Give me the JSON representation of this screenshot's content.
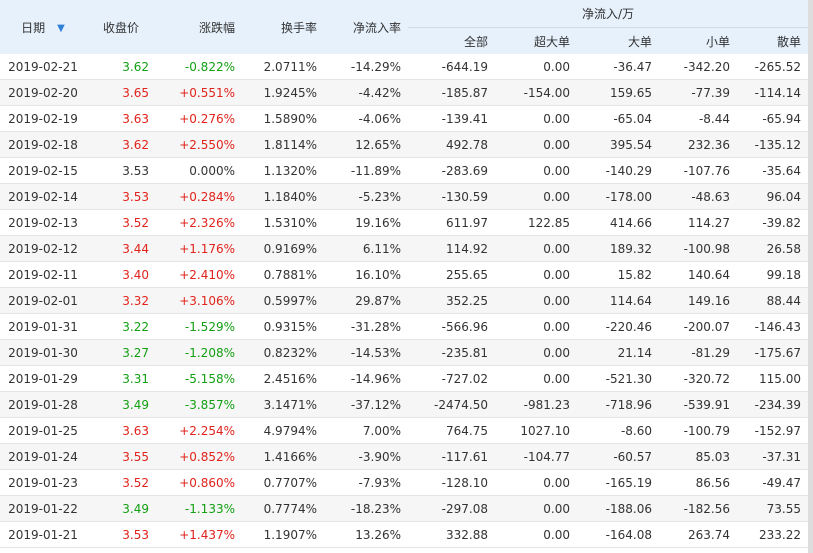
{
  "colors": {
    "up": "#e0231c",
    "down": "#129f12",
    "header_bg": "#e6f1fc"
  },
  "header": {
    "date": "日期",
    "sort_icon": "arrow-down-icon",
    "close": "收盘价",
    "change": "涨跌幅",
    "turnover": "换手率",
    "net_ratio": "净流入率",
    "net_group": "净流入/万",
    "total": "全部",
    "super_large": "超大单",
    "large": "大单",
    "small": "小单",
    "retail": "散单"
  },
  "rows": [
    {
      "date": "2019-02-21",
      "close": "3.62",
      "change": "-0.822%",
      "turnover": "2.0711%",
      "net_ratio": "-14.29%",
      "total": "-644.19",
      "super_large": "0.00",
      "large": "-36.47",
      "small": "-342.20",
      "retail": "-265.52",
      "dir": "down"
    },
    {
      "date": "2019-02-20",
      "close": "3.65",
      "change": "+0.551%",
      "turnover": "1.9245%",
      "net_ratio": "-4.42%",
      "total": "-185.87",
      "super_large": "-154.00",
      "large": "159.65",
      "small": "-77.39",
      "retail": "-114.14",
      "dir": "up"
    },
    {
      "date": "2019-02-19",
      "close": "3.63",
      "change": "+0.276%",
      "turnover": "1.5890%",
      "net_ratio": "-4.06%",
      "total": "-139.41",
      "super_large": "0.00",
      "large": "-65.04",
      "small": "-8.44",
      "retail": "-65.94",
      "dir": "up"
    },
    {
      "date": "2019-02-18",
      "close": "3.62",
      "change": "+2.550%",
      "turnover": "1.8114%",
      "net_ratio": "12.65%",
      "total": "492.78",
      "super_large": "0.00",
      "large": "395.54",
      "small": "232.36",
      "retail": "-135.12",
      "dir": "up"
    },
    {
      "date": "2019-02-15",
      "close": "3.53",
      "change": "0.000%",
      "turnover": "1.1320%",
      "net_ratio": "-11.89%",
      "total": "-283.69",
      "super_large": "0.00",
      "large": "-140.29",
      "small": "-107.76",
      "retail": "-35.64",
      "dir": "flat"
    },
    {
      "date": "2019-02-14",
      "close": "3.53",
      "change": "+0.284%",
      "turnover": "1.1840%",
      "net_ratio": "-5.23%",
      "total": "-130.59",
      "super_large": "0.00",
      "large": "-178.00",
      "small": "-48.63",
      "retail": "96.04",
      "dir": "up"
    },
    {
      "date": "2019-02-13",
      "close": "3.52",
      "change": "+2.326%",
      "turnover": "1.5310%",
      "net_ratio": "19.16%",
      "total": "611.97",
      "super_large": "122.85",
      "large": "414.66",
      "small": "114.27",
      "retail": "-39.82",
      "dir": "up"
    },
    {
      "date": "2019-02-12",
      "close": "3.44",
      "change": "+1.176%",
      "turnover": "0.9169%",
      "net_ratio": "6.11%",
      "total": "114.92",
      "super_large": "0.00",
      "large": "189.32",
      "small": "-100.98",
      "retail": "26.58",
      "dir": "up"
    },
    {
      "date": "2019-02-11",
      "close": "3.40",
      "change": "+2.410%",
      "turnover": "0.7881%",
      "net_ratio": "16.10%",
      "total": "255.65",
      "super_large": "0.00",
      "large": "15.82",
      "small": "140.64",
      "retail": "99.18",
      "dir": "up"
    },
    {
      "date": "2019-02-01",
      "close": "3.32",
      "change": "+3.106%",
      "turnover": "0.5997%",
      "net_ratio": "29.87%",
      "total": "352.25",
      "super_large": "0.00",
      "large": "114.64",
      "small": "149.16",
      "retail": "88.44",
      "dir": "up"
    },
    {
      "date": "2019-01-31",
      "close": "3.22",
      "change": "-1.529%",
      "turnover": "0.9315%",
      "net_ratio": "-31.28%",
      "total": "-566.96",
      "super_large": "0.00",
      "large": "-220.46",
      "small": "-200.07",
      "retail": "-146.43",
      "dir": "down"
    },
    {
      "date": "2019-01-30",
      "close": "3.27",
      "change": "-1.208%",
      "turnover": "0.8232%",
      "net_ratio": "-14.53%",
      "total": "-235.81",
      "super_large": "0.00",
      "large": "21.14",
      "small": "-81.29",
      "retail": "-175.67",
      "dir": "down"
    },
    {
      "date": "2019-01-29",
      "close": "3.31",
      "change": "-5.158%",
      "turnover": "2.4516%",
      "net_ratio": "-14.96%",
      "total": "-727.02",
      "super_large": "0.00",
      "large": "-521.30",
      "small": "-320.72",
      "retail": "115.00",
      "dir": "down"
    },
    {
      "date": "2019-01-28",
      "close": "3.49",
      "change": "-3.857%",
      "turnover": "3.1471%",
      "net_ratio": "-37.12%",
      "total": "-2474.50",
      "super_large": "-981.23",
      "large": "-718.96",
      "small": "-539.91",
      "retail": "-234.39",
      "dir": "down"
    },
    {
      "date": "2019-01-25",
      "close": "3.63",
      "change": "+2.254%",
      "turnover": "4.9794%",
      "net_ratio": "7.00%",
      "total": "764.75",
      "super_large": "1027.10",
      "large": "-8.60",
      "small": "-100.79",
      "retail": "-152.97",
      "dir": "up"
    },
    {
      "date": "2019-01-24",
      "close": "3.55",
      "change": "+0.852%",
      "turnover": "1.4166%",
      "net_ratio": "-3.90%",
      "total": "-117.61",
      "super_large": "-104.77",
      "large": "-60.57",
      "small": "85.03",
      "retail": "-37.31",
      "dir": "up"
    },
    {
      "date": "2019-01-23",
      "close": "3.52",
      "change": "+0.860%",
      "turnover": "0.7707%",
      "net_ratio": "-7.93%",
      "total": "-128.10",
      "super_large": "0.00",
      "large": "-165.19",
      "small": "86.56",
      "retail": "-49.47",
      "dir": "up"
    },
    {
      "date": "2019-01-22",
      "close": "3.49",
      "change": "-1.133%",
      "turnover": "0.7774%",
      "net_ratio": "-18.23%",
      "total": "-297.08",
      "super_large": "0.00",
      "large": "-188.06",
      "small": "-182.56",
      "retail": "73.55",
      "dir": "down"
    },
    {
      "date": "2019-01-21",
      "close": "3.53",
      "change": "+1.437%",
      "turnover": "1.1907%",
      "net_ratio": "13.26%",
      "total": "332.88",
      "super_large": "0.00",
      "large": "-164.08",
      "small": "263.74",
      "retail": "233.22",
      "dir": "up"
    }
  ]
}
